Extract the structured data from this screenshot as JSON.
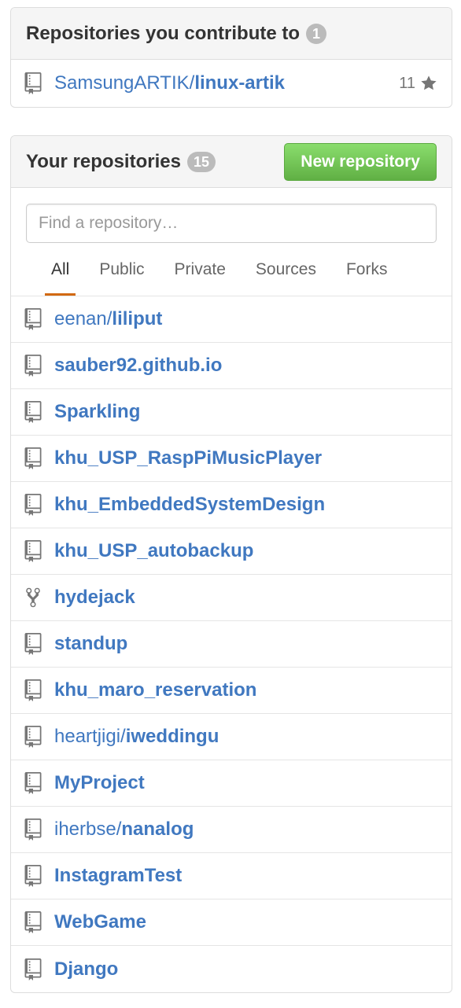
{
  "contrib": {
    "title": "Repositories you contribute to",
    "count": "1",
    "repos": [
      {
        "owner": "SamsungARTIK/",
        "name": "linux-artik",
        "stars": "11"
      }
    ]
  },
  "yours": {
    "title": "Your repositories",
    "count": "15",
    "new_button": "New repository",
    "search_placeholder": "Find a repository…",
    "tabs": [
      "All",
      "Public",
      "Private",
      "Sources",
      "Forks"
    ],
    "repos": [
      {
        "owner": "eenan/",
        "name": "liliput",
        "icon": "repo-icon"
      },
      {
        "owner": "",
        "name": "sauber92.github.io",
        "icon": "repo-icon"
      },
      {
        "owner": "",
        "name": "Sparkling",
        "icon": "repo-icon"
      },
      {
        "owner": "",
        "name": "khu_USP_RaspPiMusicPlayer",
        "icon": "repo-icon"
      },
      {
        "owner": "",
        "name": "khu_EmbeddedSystemDesign",
        "icon": "repo-icon"
      },
      {
        "owner": "",
        "name": "khu_USP_autobackup",
        "icon": "repo-icon"
      },
      {
        "owner": "",
        "name": "hydejack",
        "icon": "fork-icon"
      },
      {
        "owner": "",
        "name": "standup",
        "icon": "repo-icon"
      },
      {
        "owner": "",
        "name": "khu_maro_reservation",
        "icon": "repo-icon"
      },
      {
        "owner": "heartjigi/",
        "name": "iweddingu",
        "icon": "repo-icon"
      },
      {
        "owner": "",
        "name": "MyProject",
        "icon": "repo-icon"
      },
      {
        "owner": "iherbse/",
        "name": "nanalog",
        "icon": "repo-icon"
      },
      {
        "owner": "",
        "name": "InstagramTest",
        "icon": "repo-icon"
      },
      {
        "owner": "",
        "name": "WebGame",
        "icon": "repo-icon"
      },
      {
        "owner": "",
        "name": "Django",
        "icon": "repo-icon"
      }
    ]
  },
  "colors": {
    "link": "#4078c0",
    "accent_tab": "#d26911",
    "button": "#60b044"
  }
}
